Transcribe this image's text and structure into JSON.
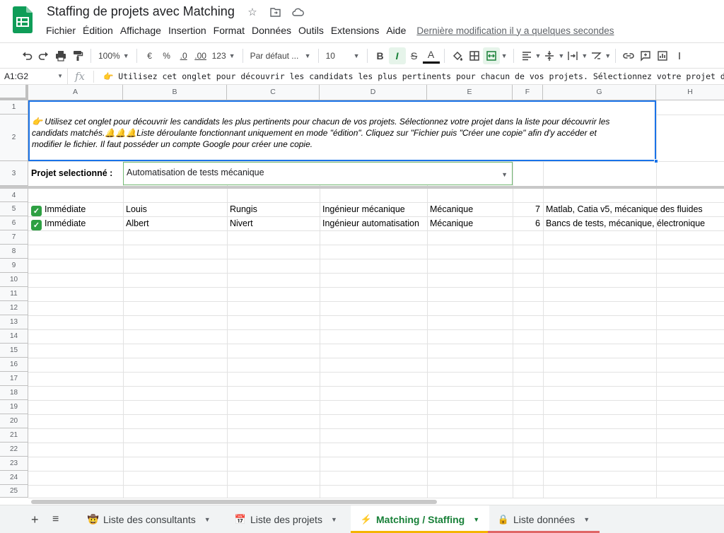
{
  "doc": {
    "title": "Staffing de projets avec Matching",
    "last_edit": "Dernière modification il y a quelques secondes"
  },
  "menu": [
    "Fichier",
    "Édition",
    "Affichage",
    "Insertion",
    "Format",
    "Données",
    "Outils",
    "Extensions",
    "Aide"
  ],
  "toolbar": {
    "zoom": "100%",
    "currency": "€",
    "percent": "%",
    "dec_decrease": ".0",
    "dec_increase": ".00",
    "more_formats": "123",
    "font": "Par défaut ...",
    "font_size": "10",
    "bold": "B",
    "italic": "I",
    "strike": "S",
    "text_color": "A"
  },
  "formula_bar": {
    "name_box": "A1:G2",
    "fx": "fx",
    "content": "👉 Utilisez cet onglet pour découvrir les candidats les plus pertinents pour chacun de vos projets. Sélectionnez votre projet dans"
  },
  "grid": {
    "columns": [
      "A",
      "B",
      "C",
      "D",
      "E",
      "F",
      "G",
      "H"
    ],
    "rows": [
      "1",
      "2",
      "3",
      "4",
      "5",
      "6",
      "7",
      "8",
      "9",
      "10",
      "11",
      "12",
      "13",
      "14",
      "15",
      "16",
      "17",
      "18",
      "19",
      "20",
      "21",
      "22",
      "23",
      "24",
      "25"
    ],
    "note_line1": "👉 Utilisez cet onglet pour découvrir les candidats les plus pertinents pour chacun de vos projets. Sélectionnez votre projet dans la liste pour découvrir les",
    "note_line2": "candidats matchés.🔔🔔🔔Liste déroulante fonctionnant uniquement en mode \"édition\". Cliquez sur \"Fichier puis \"Créer une copie\" afin d'y accéder et",
    "note_line3": "modifier le fichier. Il faut posséder un compte Google pour créer une copie.",
    "project_label": "Projet selectionné :",
    "project_value": "Automatisation de tests mécanique",
    "data_rows": [
      {
        "availability": "Immédiate",
        "first_name": "Louis",
        "city": "Rungis",
        "role": "Ingénieur mécanique",
        "domain": "Mécanique",
        "score": "7",
        "skills": "Matlab, Catia v5, mécanique des fluides"
      },
      {
        "availability": "Immédiate",
        "first_name": "Albert",
        "city": "Nivert",
        "role": "Ingénieur automatisation",
        "domain": "Mécanique",
        "score": "6",
        "skills": "Bancs de tests, mécanique, électronique"
      }
    ]
  },
  "tabs": [
    {
      "label": "Liste des consultants",
      "emoji": "🤠",
      "color": ""
    },
    {
      "label": "Liste des projets",
      "emoji": "📅",
      "color": ""
    },
    {
      "label": "Matching / Staffing",
      "emoji": "⚡",
      "color": "#f4b400"
    },
    {
      "label": "Liste données",
      "emoji": "🔒",
      "color": "#e06666"
    }
  ],
  "colors": {
    "accent": "#1a73e8",
    "sheets_green": "#0f9d58",
    "active_tab_text": "#188038"
  }
}
